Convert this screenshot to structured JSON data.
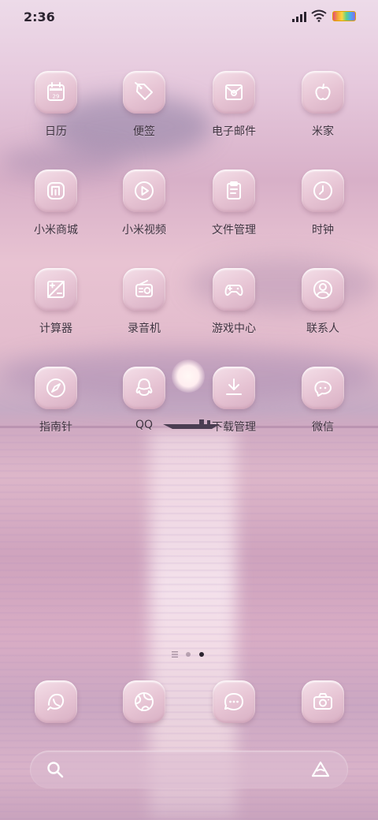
{
  "status_bar": {
    "time": "2:36",
    "icons": [
      "signal-icon",
      "wifi-icon",
      "battery-icon"
    ]
  },
  "apps": [
    {
      "label": "日历",
      "icon": "calendar-icon",
      "date": "29"
    },
    {
      "label": "便签",
      "icon": "tag-icon"
    },
    {
      "label": "电子邮件",
      "icon": "mail-icon"
    },
    {
      "label": "米家",
      "icon": "apple-icon"
    },
    {
      "label": "小米商城",
      "icon": "mi-store-icon"
    },
    {
      "label": "小米视频",
      "icon": "play-icon"
    },
    {
      "label": "文件管理",
      "icon": "clipboard-icon"
    },
    {
      "label": "时钟",
      "icon": "clock-icon"
    },
    {
      "label": "计算器",
      "icon": "calculator-icon"
    },
    {
      "label": "录音机",
      "icon": "radio-icon"
    },
    {
      "label": "游戏中心",
      "icon": "gamepad-icon"
    },
    {
      "label": "联系人",
      "icon": "contact-icon"
    },
    {
      "label": "指南针",
      "icon": "compass-icon"
    },
    {
      "label": "QQ",
      "icon": "qq-icon"
    },
    {
      "label": "下载管理",
      "icon": "download-icon"
    },
    {
      "label": "微信",
      "icon": "wechat-icon"
    }
  ],
  "page_indicator": {
    "pages": 3,
    "active": 3
  },
  "dock": [
    {
      "icon": "phone-icon"
    },
    {
      "icon": "browser-icon"
    },
    {
      "icon": "message-icon"
    },
    {
      "icon": "camera-icon"
    }
  ],
  "search_bar": {
    "left_icon": "search-icon",
    "right_icon": "assistant-icon"
  }
}
